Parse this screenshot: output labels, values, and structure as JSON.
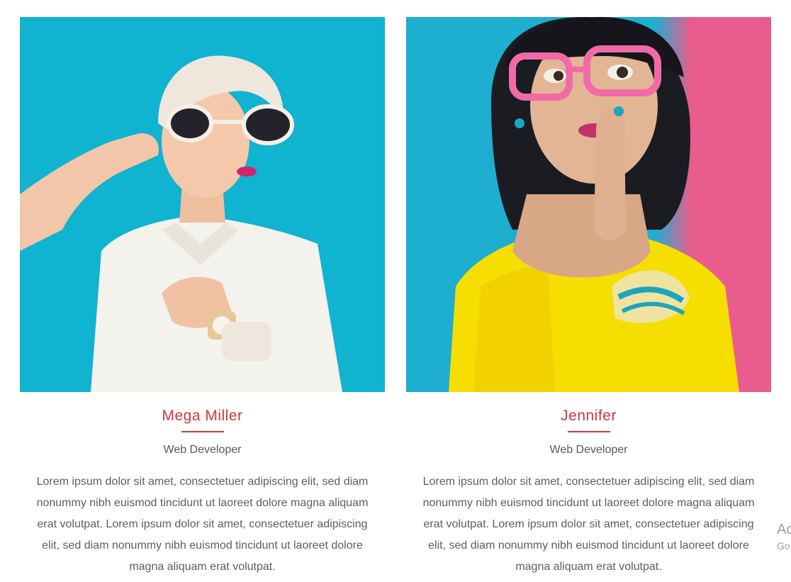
{
  "colors": {
    "accent": "#d0363c",
    "text_muted": "#5a5f66",
    "photo1_bg": "#12b7d3",
    "photo2_bg_left": "#1eaecf",
    "photo2_bg_right": "#e95d8e"
  },
  "team": [
    {
      "name": "Mega Miller",
      "role": "Web Developer",
      "bio": "Lorem ipsum dolor sit amet, consectetuer adipiscing elit, sed diam nonummy nibh euismod tincidunt ut laoreet dolore magna aliquam erat volutpat. Lorem ipsum dolor sit amet, consectetuer adipiscing elit, sed diam nonummy nibh euismod tincidunt ut laoreet dolore magna aliquam erat volutpat."
    },
    {
      "name": "Jennifer",
      "role": "Web Developer",
      "bio": "Lorem ipsum dolor sit amet, consectetuer adipiscing elit, sed diam nonummy nibh euismod tincidunt ut laoreet dolore magna aliquam erat volutpat. Lorem ipsum dolor sit amet, consectetuer adipiscing elit, sed diam nonummy nibh euismod tincidunt ut laoreet dolore magna aliquam erat volutpat."
    }
  ],
  "edge_overlay": {
    "line1": "Ac",
    "line2": "Go"
  }
}
